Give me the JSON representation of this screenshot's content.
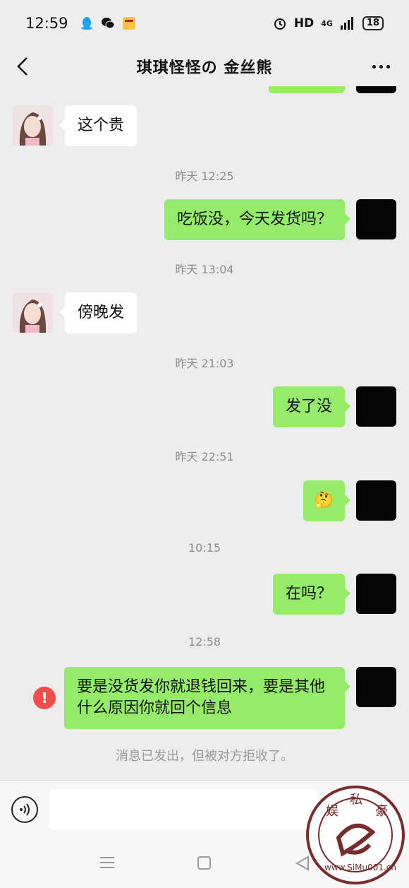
{
  "status_bar": {
    "time": "12:59",
    "network": "HD",
    "signal": "4G",
    "battery": "18"
  },
  "header": {
    "title": "琪琪怪怪の 金丝熊"
  },
  "messages": [
    {
      "type": "in",
      "text": "这个贵"
    },
    {
      "type": "time",
      "text": "昨天 12:25"
    },
    {
      "type": "out",
      "text": "吃饭没，今天发货吗？"
    },
    {
      "type": "time",
      "text": "昨天 13:04"
    },
    {
      "type": "in",
      "text": "傍晚发"
    },
    {
      "type": "time",
      "text": "昨天 21:03"
    },
    {
      "type": "out",
      "text": "发了没"
    },
    {
      "type": "time",
      "text": "昨天 22:51"
    },
    {
      "type": "out_emoji",
      "text": "🤔"
    },
    {
      "type": "time",
      "text": "10:15"
    },
    {
      "type": "out",
      "text": "在吗？"
    },
    {
      "type": "time",
      "text": "12:58"
    },
    {
      "type": "out_failed",
      "text": "要是没货发你就退钱回来，要是其他什么原因你就回个信息"
    }
  ],
  "system_note": "消息已发出，但被对方拒收了。",
  "input": {
    "placeholder": ""
  },
  "watermark": {
    "chars": [
      "娱",
      "私",
      "豪"
    ],
    "url": "www.SiMu001.cn"
  },
  "colors": {
    "out_bubble": "#95ec69",
    "in_bubble": "#ffffff",
    "background": "#ededed",
    "error": "#f04d4d"
  }
}
